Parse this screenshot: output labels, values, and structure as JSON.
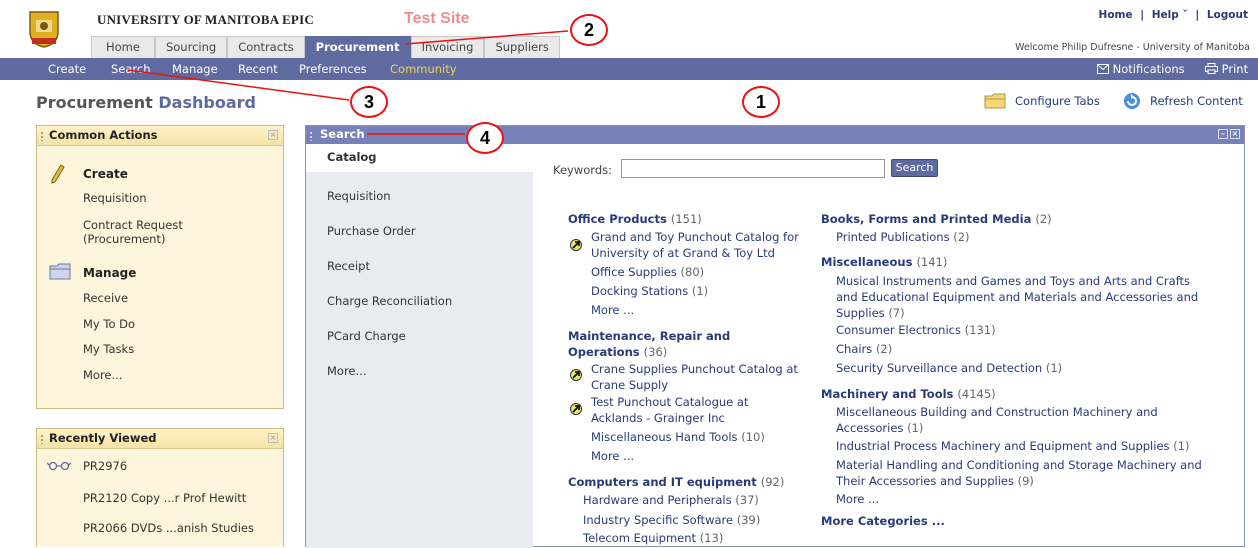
{
  "header": {
    "brand": "UNIVERSITY OF MANITOBA  EPIC",
    "test_site": "Test Site",
    "links": {
      "home": "Home",
      "sep1": "|",
      "help": "Help ˇ",
      "sep2": "|",
      "logout": "Logout"
    },
    "welcome": "Welcome Philip Dufresne - University of Manitoba"
  },
  "tabs": [
    "Home",
    "Sourcing",
    "Contracts",
    "Procurement",
    "Invoicing",
    "Suppliers"
  ],
  "active_tab": "Procurement",
  "subnav": {
    "items": [
      "Create",
      "Search",
      "Manage",
      "Recent",
      "Preferences",
      "Community"
    ],
    "notifications": "Notifications",
    "print": "Print"
  },
  "page": {
    "title_part1": "Procurement",
    "title_part2": "Dashboard",
    "configure_tabs": "Configure Tabs",
    "refresh_content": "Refresh Content"
  },
  "common_actions": {
    "title": "Common Actions",
    "create_heading": "Create",
    "requisition": "Requisition",
    "contract_request_1": "Contract Request",
    "contract_request_2": "(Procurement)",
    "manage_heading": "Manage",
    "receive": "Receive",
    "my_todo": "My To Do",
    "my_tasks": "My Tasks",
    "more": "More..."
  },
  "recently_viewed": {
    "title": "Recently Viewed",
    "items": [
      "PR2976",
      "PR2120 Copy ...r Prof Hewitt",
      "PR2066 DVDs ...anish Studies"
    ]
  },
  "search": {
    "title": "Search",
    "menu": [
      "Catalog",
      "Requisition",
      "Purchase Order",
      "Receipt",
      "Charge Reconciliation",
      "PCard Charge",
      "More..."
    ],
    "keywords_label": "Keywords:",
    "keywords_value": "",
    "button": "Search",
    "col1": {
      "office": {
        "name": "Office Products",
        "count": "(151)",
        "punchout1": "Grand and Toy Punchout Catalog for",
        "punchout2": "University of at Grand & Toy Ltd",
        "supplies": "Office Supplies",
        "supplies_count": "(80)",
        "docking": "Docking Stations",
        "docking_count": "(1)",
        "more": "More ..."
      },
      "mro": {
        "name1": "Maintenance, Repair and",
        "name2": "Operations",
        "count": "(36)",
        "crane1": "Crane Supplies Punchout Catalog at",
        "crane2": "Crane Supply",
        "test1": "Test Punchout Catalogue at",
        "test2": "Acklands - Grainger Inc",
        "hand": "Miscellaneous Hand Tools",
        "hand_count": "(10)",
        "more": "More ..."
      },
      "computers": {
        "name": "Computers and IT equipment",
        "count": "(92)",
        "hw": "Hardware and Peripherals",
        "hw_count": "(37)",
        "sw": "Industry Specific Software",
        "sw_count": "(39)",
        "tel": "Telecom Equipment",
        "tel_count": "(13)"
      }
    },
    "col2": {
      "books": {
        "name": "Books, Forms and Printed Media",
        "count": "(2)",
        "pub": "Printed Publications",
        "pub_count": "(2)"
      },
      "misc": {
        "name": "Miscellaneous",
        "count": "(141)",
        "mus1": "Musical Instruments and Games and Toys and Arts and Crafts",
        "mus2": "and Educational Equipment and Materials and Accessories and",
        "mus3": "Supplies",
        "mus_count": "(7)",
        "ce": "Consumer Electronics",
        "ce_count": "(131)",
        "chairs": "Chairs",
        "chairs_count": "(2)",
        "sec": "Security Surveillance and Detection",
        "sec_count": "(1)"
      },
      "machinery": {
        "name": "Machinery and Tools",
        "count": "(4145)",
        "mb1": "Miscellaneous Building and Construction Machinery and",
        "mb2": "Accessories",
        "mb_count": "(1)",
        "ip": "Industrial Process Machinery and Equipment and Supplies",
        "ip_count": "(1)",
        "mh1": "Material Handling and Conditioning and Storage Machinery and",
        "mh2": "Their Accessories and Supplies",
        "mh_count": "(9)",
        "more": "More ..."
      },
      "more_categories": "More Categories ..."
    }
  },
  "annotations": [
    "1",
    "2",
    "3",
    "4"
  ],
  "colors": {
    "nav": "#5f6aa0",
    "link": "#2a3a78",
    "annotation": "#e11111",
    "test_site": "#f08c8c"
  }
}
